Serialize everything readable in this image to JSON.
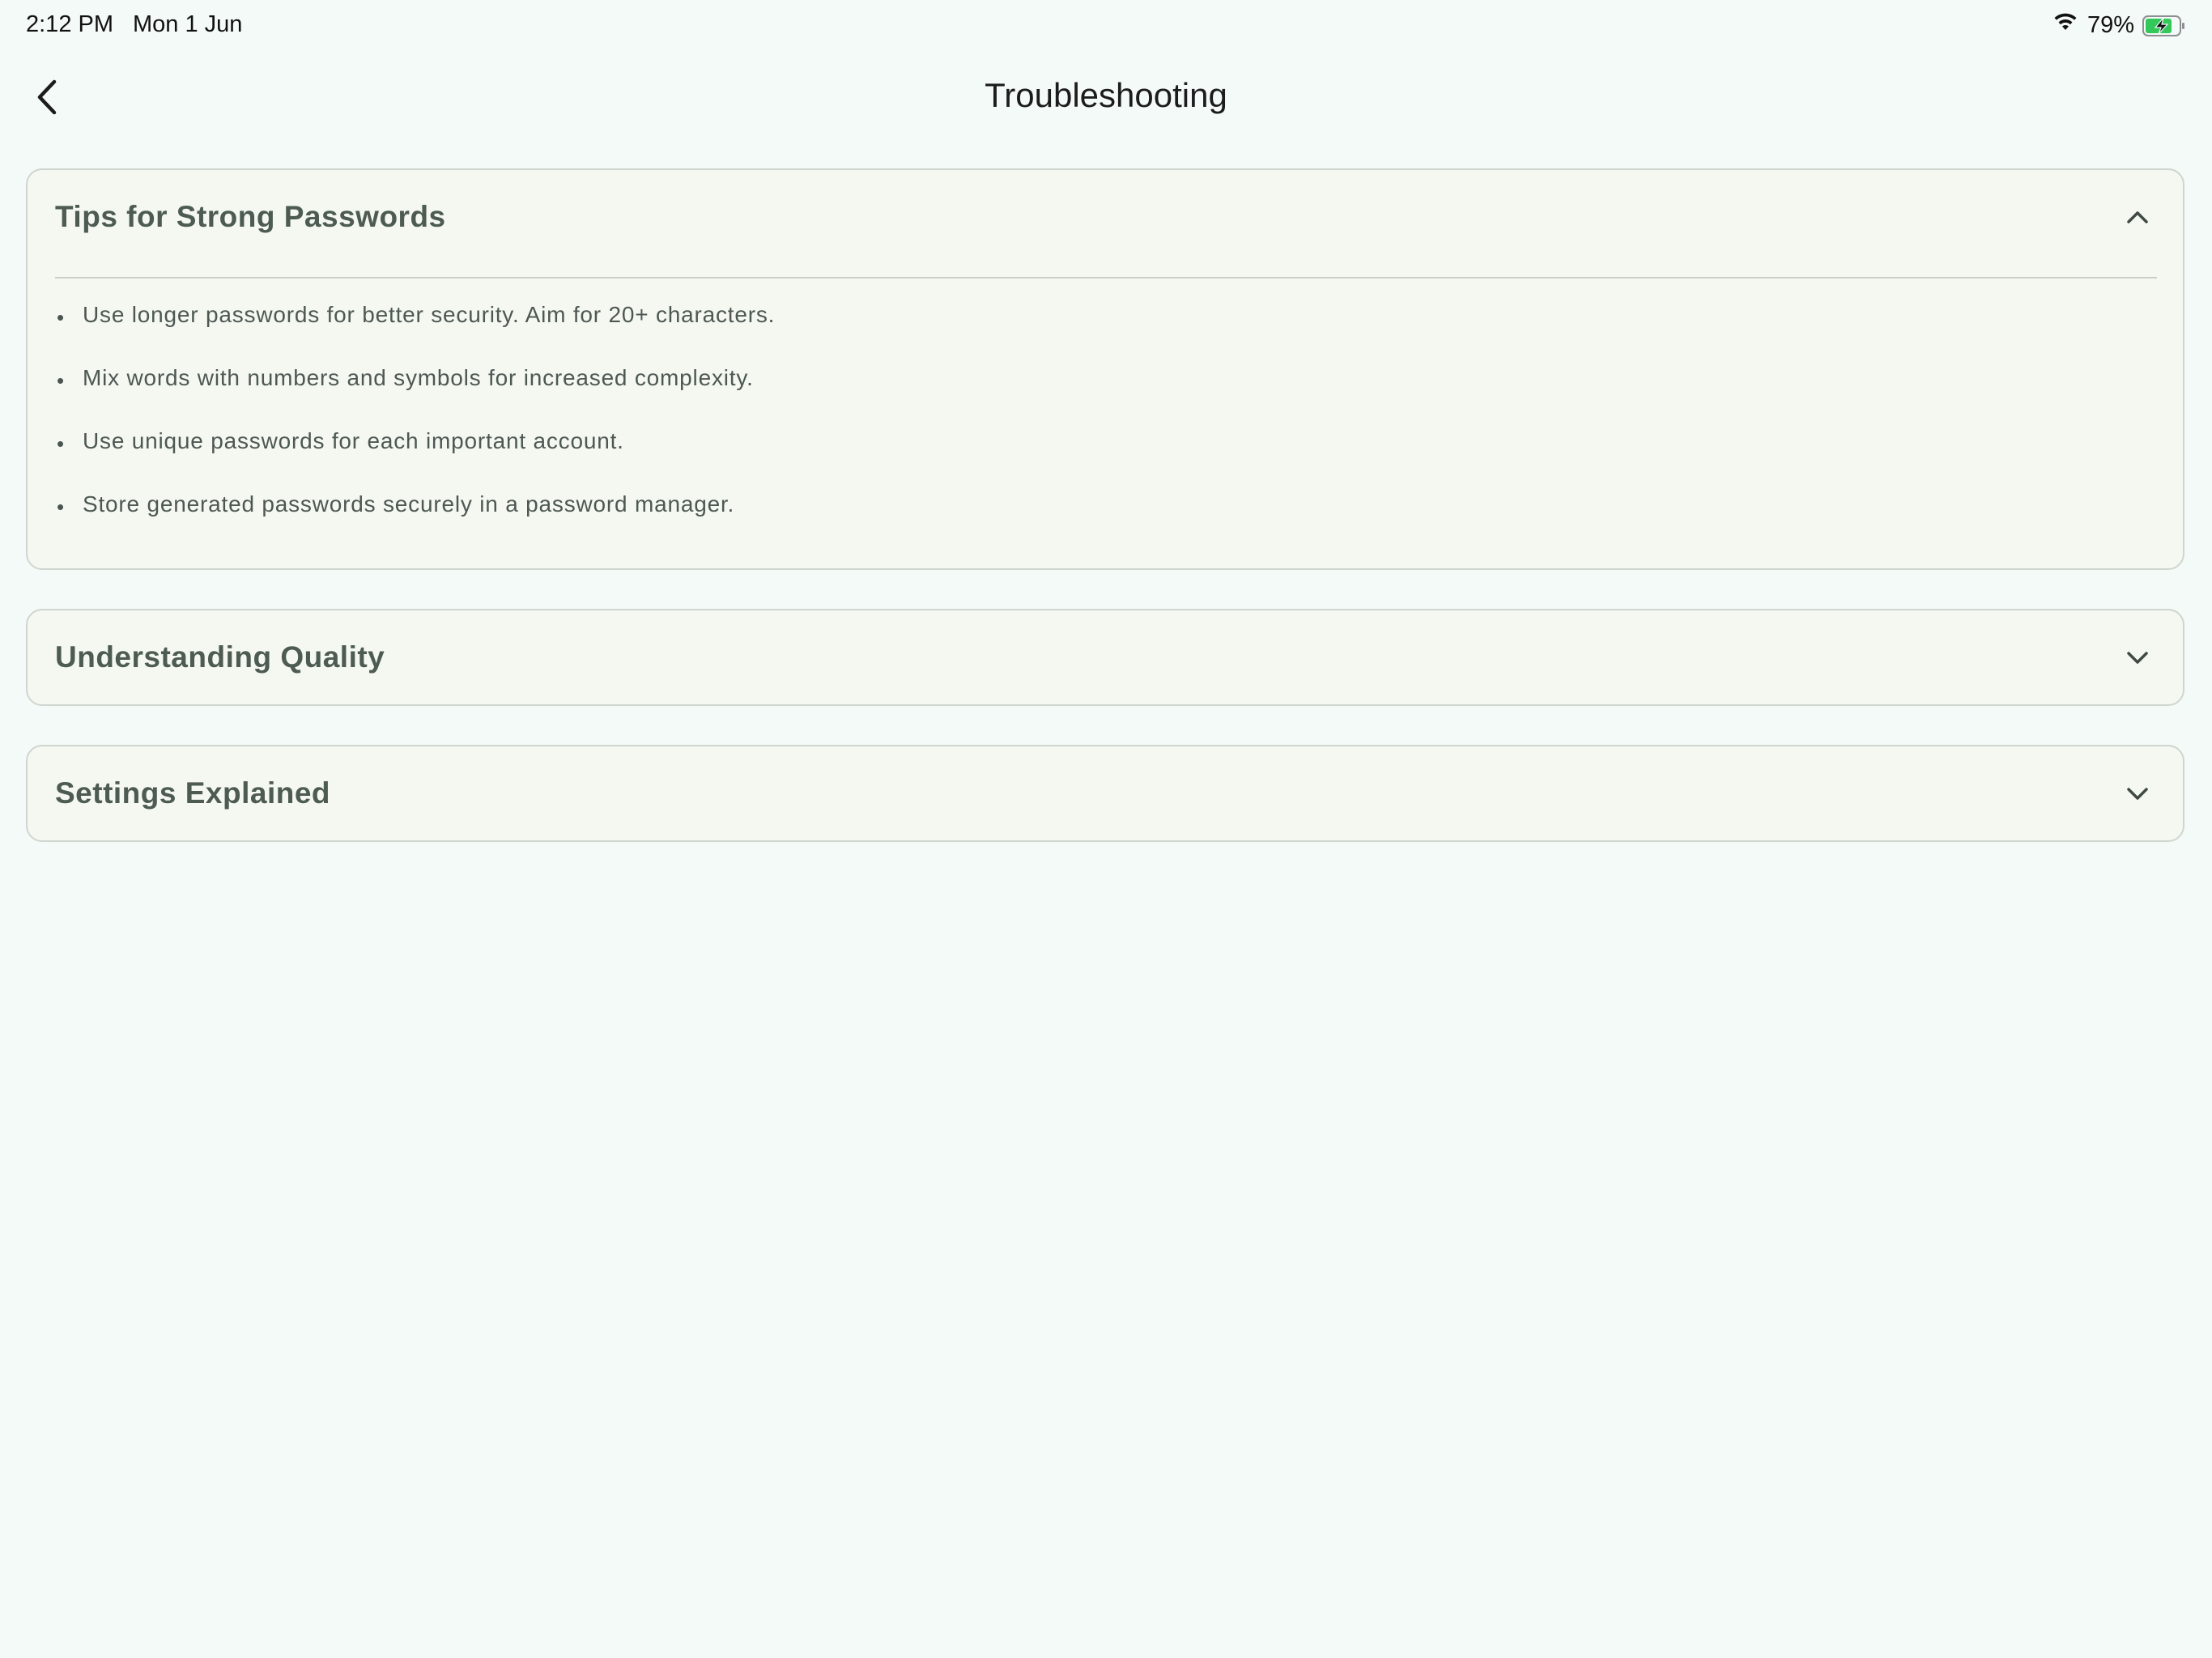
{
  "status_bar": {
    "time": "2:12 PM",
    "date": "Mon 1 Jun",
    "battery_percent": "79%",
    "wifi_icon": "wifi-icon",
    "battery_icon": "battery-charging-icon",
    "battery_color": "#34c759"
  },
  "nav": {
    "title": "Troubleshooting",
    "back_icon": "chevron-left-icon"
  },
  "sections": [
    {
      "title": "Tips for Strong Passwords",
      "expanded": true,
      "chevron_icon": "chevron-up-icon",
      "tips": [
        "Use longer passwords for better security. Aim for 20+ characters.",
        "Mix words with numbers and symbols for increased complexity.",
        "Use unique passwords for each important account.",
        "Store generated passwords securely in a password manager."
      ]
    },
    {
      "title": "Understanding Quality",
      "expanded": false,
      "chevron_icon": "chevron-down-icon"
    },
    {
      "title": "Settings Explained",
      "expanded": false,
      "chevron_icon": "chevron-down-icon"
    }
  ],
  "colors": {
    "background": "#f4faf7",
    "card_background": "#f4f8f1",
    "card_border": "#cfd6cf",
    "section_title": "#4d5b52",
    "body_text": "#4e5853"
  }
}
